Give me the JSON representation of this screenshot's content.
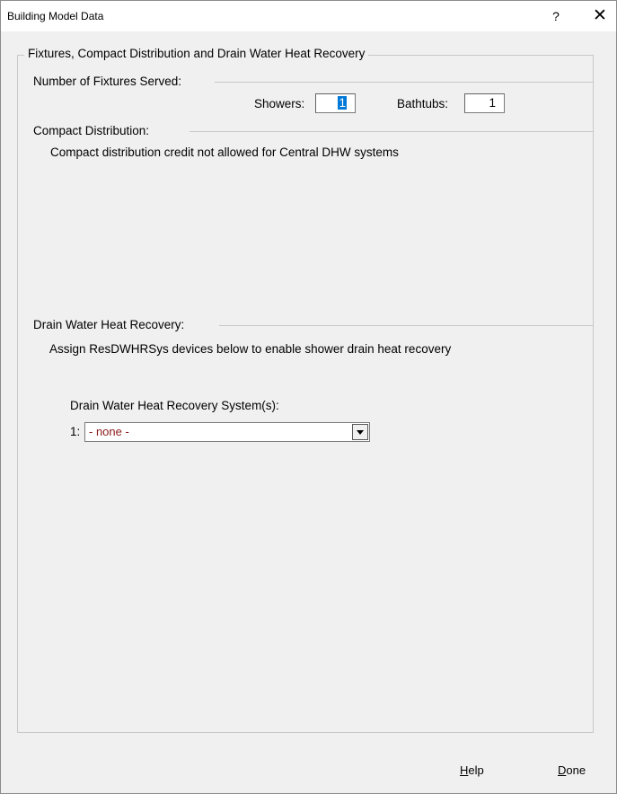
{
  "window": {
    "title": "Building Model Data",
    "help_glyph": "?",
    "close_glyph": "✕"
  },
  "group": {
    "legend": "Fixtures, Compact Distribution and Drain Water Heat Recovery"
  },
  "fixtures": {
    "heading": "Number of Fixtures Served:",
    "showers_label": "Showers:",
    "showers_value": "1",
    "bathtubs_label": "Bathtubs:",
    "bathtubs_value": "1"
  },
  "compact": {
    "heading": "Compact Distribution:",
    "note": "Compact distribution credit not allowed for Central DHW systems"
  },
  "dwhr": {
    "heading": "Drain Water Heat Recovery:",
    "note": "Assign ResDWHRSys devices below to enable shower drain heat recovery",
    "systems_label": "Drain Water Heat Recovery System(s):",
    "row_index": "1:",
    "selected": "- none -"
  },
  "buttons": {
    "help_first": "H",
    "help_rest": "elp",
    "done_first": "D",
    "done_rest": "one"
  }
}
